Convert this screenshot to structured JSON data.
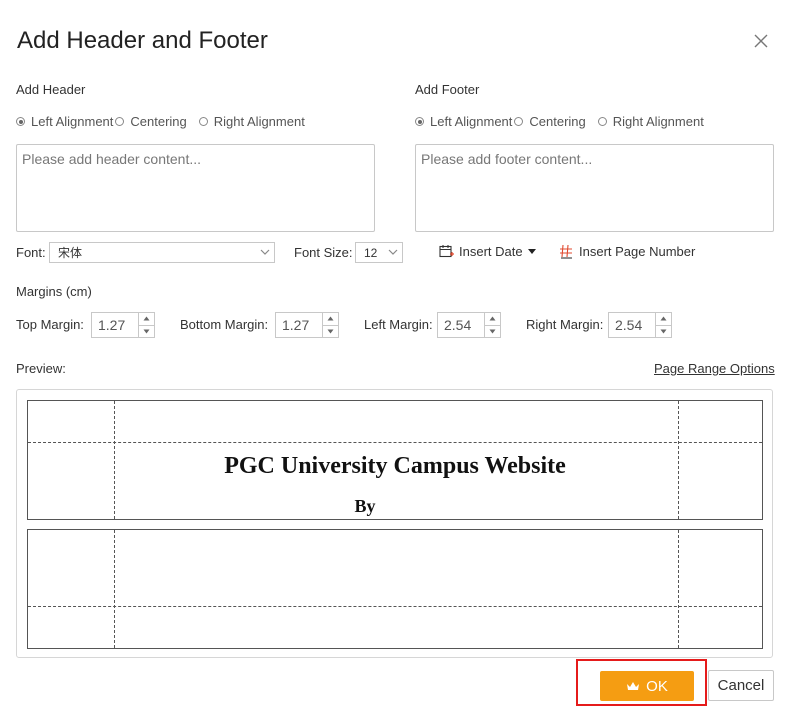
{
  "dialog": {
    "title": "Add Header and Footer"
  },
  "header_section": {
    "label": "Add Header",
    "alignments": [
      "Left Alignment",
      "Centering",
      "Right Alignment"
    ],
    "placeholder": "Please add header content..."
  },
  "footer_section": {
    "label": "Add Footer",
    "alignments": [
      "Left Alignment",
      "Centering",
      "Right Alignment"
    ],
    "placeholder": "Please add footer content..."
  },
  "font": {
    "label": "Font:",
    "value": "宋体"
  },
  "font_size": {
    "label": "Font Size:",
    "value": "12"
  },
  "tools": {
    "insert_date": "Insert Date",
    "insert_page_number": "Insert Page Number"
  },
  "margins": {
    "label": "Margins (cm)",
    "top": {
      "label": "Top Margin:",
      "value": "1.27"
    },
    "bottom": {
      "label": "Bottom Margin:",
      "value": "1.27"
    },
    "left": {
      "label": "Left Margin:",
      "value": "2.54"
    },
    "right": {
      "label": "Right Margin:",
      "value": "2.54"
    }
  },
  "preview": {
    "label": "Preview:",
    "page_range_link": "Page Range Options",
    "title_line": "PGC University Campus Website",
    "by_line": "By"
  },
  "buttons": {
    "ok": "OK",
    "cancel": "Cancel"
  },
  "colors": {
    "ok_button": "#f59d12",
    "highlight_border": "#e51b1b"
  }
}
